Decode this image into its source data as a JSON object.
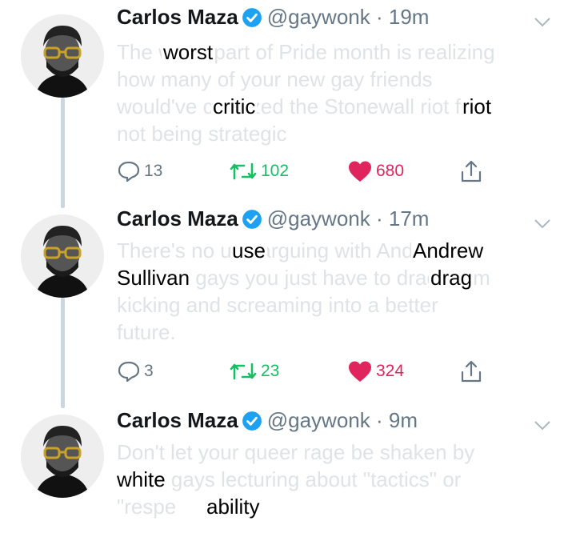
{
  "tweets": [
    {
      "name": "Carlos Maza",
      "handle": "@gaywonk",
      "time": "19m",
      "lines": [
        "The worst part of Pride month is realizing",
        "how many of your new gay friends",
        "would've criticized the Stonewall riot for",
        "not being strategic"
      ],
      "overlays": [
        "worst",
        "critic",
        "riot"
      ],
      "replies": "13",
      "retweets": "102",
      "likes": "680"
    },
    {
      "name": "Carlos Maza",
      "handle": "@gaywonk",
      "time": "17m",
      "lines": [
        "There's no use arguing with Andrew",
        "Sullivan gays you just have to drag them",
        "kicking and screaming into a better",
        "future."
      ],
      "overlays": [
        "use",
        "Andrew",
        "Sullivan",
        "drag"
      ],
      "replies": "3",
      "retweets": "23",
      "likes": "324"
    },
    {
      "name": "Carlos Maza",
      "handle": "@gaywonk",
      "time": "9m",
      "lines": [
        "Don't let your queer rage be shaken by",
        "white gays lecturing about \"tactics\" or",
        "\"respe"
      ],
      "overlays": [
        "white",
        "ability"
      ]
    }
  ],
  "colors": {
    "verified": "#1da1f2",
    "retweet": "#17bf63",
    "like": "#e0245e",
    "muted": "#657786"
  },
  "icons": [
    "verified-badge-icon",
    "chevron-down-icon",
    "reply-icon",
    "retweet-icon",
    "heart-icon",
    "share-icon",
    "avatar"
  ]
}
